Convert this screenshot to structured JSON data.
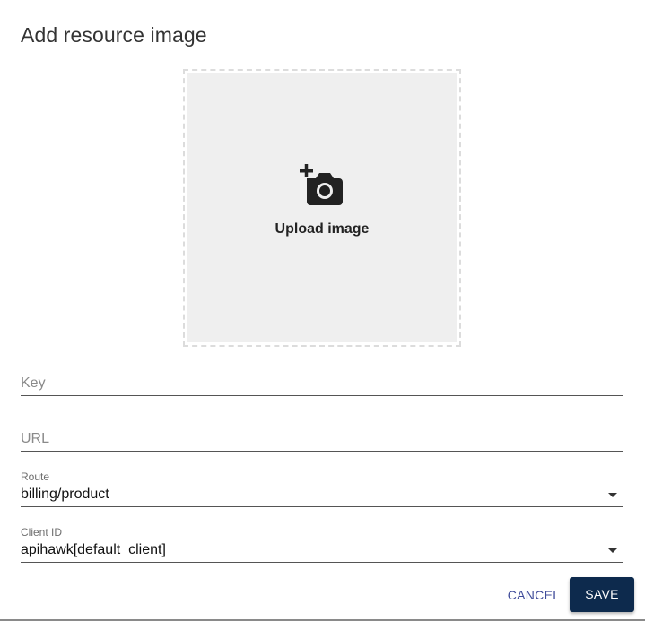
{
  "dialog": {
    "title": "Add resource image"
  },
  "upload": {
    "label": "Upload image",
    "icon": "add-a-photo-icon"
  },
  "fields": {
    "key": {
      "placeholder": "Key",
      "value": ""
    },
    "url": {
      "placeholder": "URL",
      "value": ""
    },
    "route": {
      "label": "Route",
      "value": "billing/product",
      "icon": "arrow-drop-down-icon"
    },
    "client_id": {
      "label": "Client ID",
      "value": "apihawk[default_client]",
      "icon": "arrow-drop-down-icon"
    }
  },
  "actions": {
    "cancel_label": "CANCEL",
    "save_label": "SAVE"
  },
  "colors": {
    "primary": "#0d2a4d",
    "cancel_text": "#3e4a99",
    "upload_bg": "#efefef"
  }
}
